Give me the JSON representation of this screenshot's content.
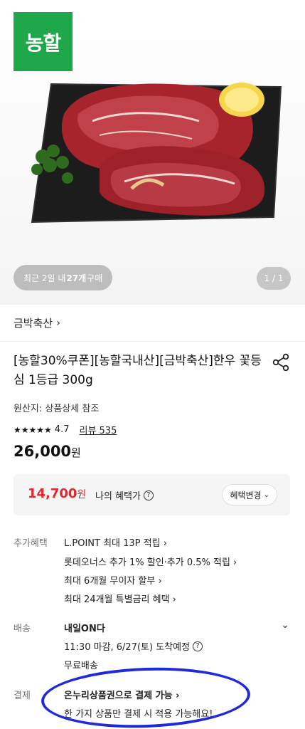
{
  "hero": {
    "badge": "농할",
    "recent_prefix": "최근 2일 내 ",
    "recent_count": "27개",
    "recent_suffix": " 구매",
    "page_counter": "1 / 1"
  },
  "brand": {
    "name": "금박축산",
    "chevron": "›"
  },
  "product": {
    "title": "[농할30%쿠폰][농할국내산][금박축산]한우 꽃등심 1등급 300g",
    "origin": "원산지: 상품상세 참조",
    "stars": "★★★★★",
    "rating": "4.7",
    "review": "리뷰 535",
    "price": "26,000",
    "price_unit": "원"
  },
  "benefit": {
    "price": "14,700",
    "price_unit": "원",
    "label": "나의 혜택가",
    "help": "?",
    "change_button": "혜택변경",
    "change_chevron": "⌄"
  },
  "extra": {
    "label": "추가혜택",
    "items": [
      "L.POINT 최대 13P 적립 ›",
      "롯데오너스 추가 1% 할인·추가 0.5% 적립 ›",
      "최대 6개월 무이자 할부 ›",
      "최대 24개월 특별금리 혜택 ›"
    ]
  },
  "delivery": {
    "label": "배송",
    "type": "내일ON다",
    "schedule": "11:30 마감, 6/27(토) 도착예정",
    "help": "?",
    "fee": "무료배송",
    "expand": "⌄"
  },
  "payment": {
    "label": "결제",
    "method": "온누리상품권으로 결제 가능 ›",
    "note": "한 가지 상품만 결제 시 적용 가능해요!"
  },
  "colors": {
    "brand_green": "#1fa84a",
    "sale_red": "#e0282e",
    "annotation_blue": "#1f2ad8"
  }
}
